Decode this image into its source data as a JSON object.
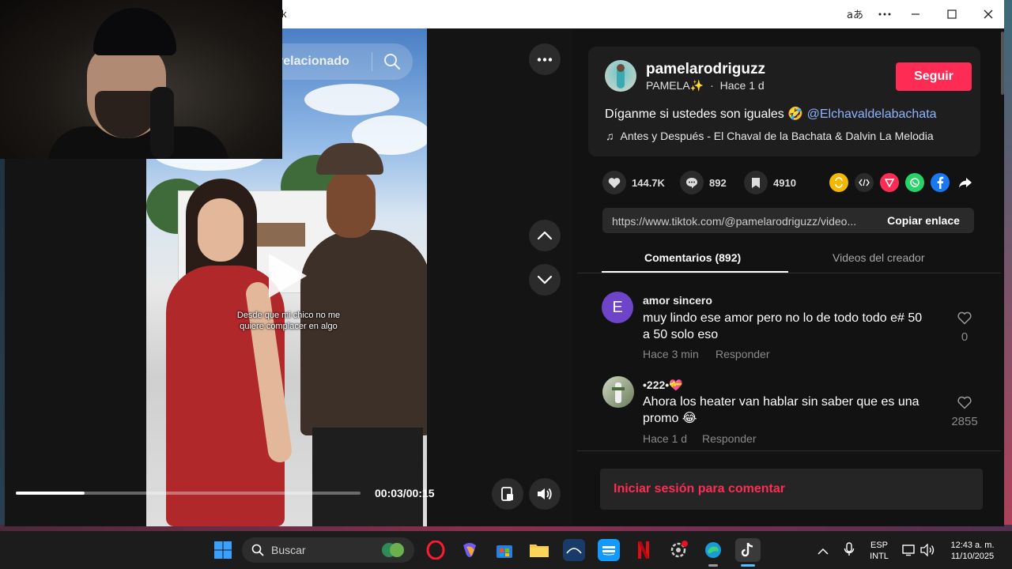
{
  "window": {
    "title": "k",
    "controls": [
      "translate-icon",
      "more-icon",
      "minimize-icon",
      "maximize-icon",
      "close-icon"
    ]
  },
  "video": {
    "search_placeholder": "relacionado",
    "caption": "Desde que mi chico no me quiere complacer en algo",
    "time": "00:03/00:15",
    "progress": 0.2
  },
  "post": {
    "username": "pamelarodriguzz",
    "display_name": "PAMELA✨",
    "separator": "·",
    "posted": "Hace 1 d",
    "follow_label": "Seguir",
    "description": "Díganme si ustedes son iguales 🤣",
    "mention": "@Elchavaldelabachata",
    "music": "Antes y Después - El Chaval de la Bachata & Dalvin La Melodia"
  },
  "stats": {
    "likes": "144.7K",
    "comments": "892",
    "saves": "4910"
  },
  "link": {
    "url": "https://www.tiktok.com/@pamelarodriguzz/video...",
    "copy_label": "Copiar enlace"
  },
  "tabs": {
    "comments": "Comentarios (892)",
    "creator_videos": "Videos del creador"
  },
  "comments": [
    {
      "initial": "E",
      "name": "amor sincero",
      "text_line1": "muy lindo ese amor pero no lo de todo todo e# 50",
      "text_line2": "a 50 solo eso",
      "time": "Hace 3 min",
      "reply": "Responder",
      "likes": "0"
    },
    {
      "name": "•222•💝",
      "text_line1": "Ahora los heater van hablar sin saber que es una",
      "text_line2": "promo 😂",
      "time": "Hace 1 d",
      "reply": "Responder",
      "likes": "2855"
    }
  ],
  "login": {
    "label": "Iniciar sesión para comentar"
  },
  "taskbar": {
    "search_label": "Buscar",
    "lang_top": "ESP",
    "lang_bottom": "INTL",
    "time": "12:43 a. m.",
    "date": "11/10/2025"
  },
  "colors": {
    "accent": "#fe2c55",
    "mention": "#8fb5ff",
    "panel_bg": "#121212"
  }
}
